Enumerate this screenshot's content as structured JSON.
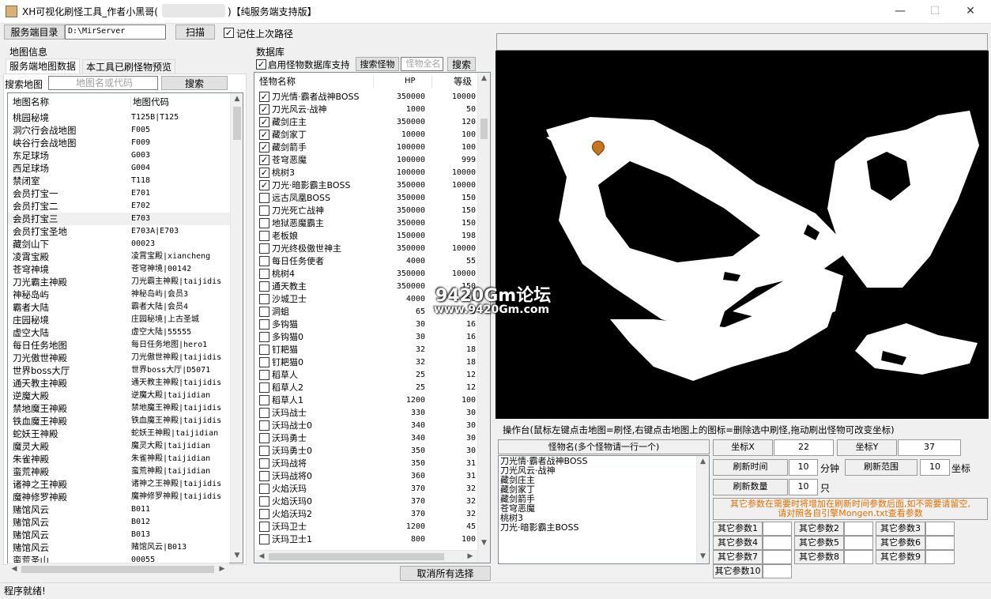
{
  "window": {
    "title_prefix": "XH可视化刷怪工具_作者小黑哥(",
    "title_suffix": ")【纯服务端支持版】",
    "minimize": "—",
    "maximize": "☐",
    "close": "✕"
  },
  "toolbar": {
    "server_dir_label": "服务端目录",
    "server_dir_value": "D:\\MirServer",
    "scan_button": "扫描",
    "remember_label": "记住上次路径",
    "remember_checked": true
  },
  "map_info": {
    "section_title": "地图信息",
    "tab_server": "服务端地图数据",
    "tab_existing": "本工具已刷怪物预览",
    "search_label": "搜索地图",
    "search_placeholder": "地图名或代码",
    "search_button": "搜索",
    "col_name": "地图名称",
    "col_code": "地图代码",
    "rows": [
      [
        "桃园秘境",
        "T125B|T125"
      ],
      [
        "洞穴行会战地图",
        "F005"
      ],
      [
        "峡谷行会战地图",
        "F009"
      ],
      [
        "东足球场",
        "G003"
      ],
      [
        "西足球场",
        "G004"
      ],
      [
        "禁闭室",
        "T118"
      ],
      [
        "会员打宝一",
        "E701"
      ],
      [
        "会员打宝二",
        "E702"
      ],
      [
        "会员打宝三",
        "E703"
      ],
      [
        "会员打宝圣地",
        "E703A|E703"
      ],
      [
        "藏剑山下",
        "00023"
      ],
      [
        "凌霄宝殿",
        "凌霄宝殿|xiancheng"
      ],
      [
        "苍穹神境",
        "苍穹神境|00142"
      ],
      [
        "刀光霸主神殿",
        "刀光霸主神殿|taijidis"
      ],
      [
        "神秘岛屿",
        "神秘岛屿|会员3"
      ],
      [
        "霸者大陆",
        "霸者大陆|会员4"
      ],
      [
        "庄园秘境",
        "庄园秘境|上古圣城"
      ],
      [
        "虚空大陆",
        "虚空大陆|55555"
      ],
      [
        "每日任务地图",
        "每日任务地图|hero1"
      ],
      [
        "刀光傲世神殿",
        "刀光傲世神殿|taijidis"
      ],
      [
        "世界boss大厅",
        "世界boss大厅|D5071"
      ],
      [
        "通天教主神殿",
        "通天教主神殿|taijidis"
      ],
      [
        "逆魔大殿",
        "逆魔大殿|taijidian"
      ],
      [
        "禁地魔王神殿",
        "禁地魔王神殿|taijidis"
      ],
      [
        "铁血魔王神殿",
        "铁血魔王神殿|taijidis"
      ],
      [
        "蛇妖王神殿",
        "蛇妖王神殿|taijidian"
      ],
      [
        "魔灵大殿",
        "魔灵大殿|taijidian"
      ],
      [
        "朱雀神殿",
        "朱雀神殿|taijidian"
      ],
      [
        "蛮荒神殿",
        "蛮荒神殿|taijidian"
      ],
      [
        "诸神之王神殿",
        "诸神之王神殿|taijidis"
      ],
      [
        "魔神修罗神殿",
        "魔神修罗神殿|taijidis"
      ],
      [
        "赌馆风云",
        "B011"
      ],
      [
        "赌馆风云",
        "B012"
      ],
      [
        "赌馆风云",
        "B013"
      ],
      [
        "赌馆风云",
        "赌馆风云|B013"
      ],
      [
        "蛮荒圣山",
        "00055"
      ]
    ]
  },
  "monster_db": {
    "section_title": "数据库",
    "enable_label": "启用怪物数据库支持",
    "enable_checked": true,
    "search_monster_button": "搜索怪物",
    "fullname_placeholder": "怪物全名",
    "search_button": "搜索",
    "col_name": "怪物名称",
    "col_hp": "HP",
    "col_level": "等级",
    "cancel_all": "取消所有选择",
    "rows": [
      [
        true,
        "刀光情·霸者战神BOSS",
        "350000",
        "10000"
      ],
      [
        true,
        "刀光风云·战神",
        "1000",
        "50"
      ],
      [
        true,
        "藏剑庄主",
        "350000",
        "120"
      ],
      [
        true,
        "藏剑家丁",
        "10000",
        "100"
      ],
      [
        true,
        "藏剑箭手",
        "100000",
        "100"
      ],
      [
        true,
        "苍穹恶魔",
        "100000",
        "999"
      ],
      [
        true,
        "桃树3",
        "100000",
        "10000"
      ],
      [
        true,
        "刀光·暗影霸主BOSS",
        "350000",
        "10000"
      ],
      [
        false,
        "远古凤凰BOSS",
        "350000",
        "150"
      ],
      [
        false,
        "刀光死亡战神",
        "350000",
        "150"
      ],
      [
        false,
        "地狱恶魔霸主",
        "350000",
        "150"
      ],
      [
        false,
        "老板娘",
        "150000",
        "198"
      ],
      [
        false,
        "刀光终极傲世神主",
        "350000",
        "10000"
      ],
      [
        false,
        "每日任务使者",
        "4000",
        "55"
      ],
      [
        false,
        "桃树4",
        "350000",
        "10000"
      ],
      [
        false,
        "通天教主",
        "350000",
        "150"
      ],
      [
        false,
        "沙城卫士",
        "4000",
        "150"
      ],
      [
        false,
        "洞蛆",
        "65",
        "9"
      ],
      [
        false,
        "多钩猫",
        "30",
        "16"
      ],
      [
        false,
        "多钩猫0",
        "30",
        "16"
      ],
      [
        false,
        "钉耙猫",
        "32",
        "18"
      ],
      [
        false,
        "钉耙猫0",
        "32",
        "18"
      ],
      [
        false,
        "稻草人",
        "25",
        "12"
      ],
      [
        false,
        "稻草人2",
        "25",
        "12"
      ],
      [
        false,
        "稻草人1",
        "1200",
        "100"
      ],
      [
        false,
        "沃玛战士",
        "330",
        "30"
      ],
      [
        false,
        "沃玛战士0",
        "340",
        "30"
      ],
      [
        false,
        "沃玛勇士",
        "340",
        "30"
      ],
      [
        false,
        "沃玛勇士0",
        "350",
        "30"
      ],
      [
        false,
        "沃玛战将",
        "350",
        "31"
      ],
      [
        false,
        "沃玛战将0",
        "360",
        "31"
      ],
      [
        false,
        "火焰沃玛",
        "370",
        "32"
      ],
      [
        false,
        "火焰沃玛0",
        "370",
        "32"
      ],
      [
        false,
        "火焰沃玛2",
        "370",
        "32"
      ],
      [
        false,
        "沃玛卫士",
        "1200",
        "45"
      ],
      [
        false,
        "沃玛卫士1",
        "800",
        "100"
      ]
    ]
  },
  "map_view": {
    "watermark_top": "9420Gm论坛",
    "watermark_bottom": "www.9420Gm.com",
    "marker_icon": "map-pin-icon"
  },
  "console": {
    "title": "操作台(鼠标左键点击地图=刷怪,右键点击地图上的图标=删除选中刷怪,拖动刷出怪物可改变坐标)",
    "monster_name_header": "怪物名(多个怪物请一行一个)",
    "monster_lines": [
      "刀光情·霸者战神BOSS",
      "刀光风云·战神",
      "藏剑庄主",
      "藏剑家丁",
      "藏剑箭手",
      "苍穹恶魔",
      "桃树3",
      "刀光·暗影霸主BOSS"
    ],
    "coord_x_label": "坐标X",
    "coord_x_value": "22",
    "coord_y_label": "坐标Y",
    "coord_y_value": "37",
    "refresh_time_label": "刷新时间",
    "refresh_time_value": "10",
    "refresh_time_unit": "分钟",
    "refresh_range_label": "刷新范围",
    "refresh_range_value": "10",
    "refresh_range_unit": "坐标",
    "refresh_count_label": "刷新数量",
    "refresh_count_value": "10",
    "refresh_count_unit": "只",
    "note_line1": "其它参数在需要时将增加在刷新时间参数后面,如不需要请留空,",
    "note_line2": "请对照各自引擎Mongen.txt查看参数",
    "params": [
      "其它参数1",
      "其它参数2",
      "其它参数3",
      "其它参数4",
      "其它参数5",
      "其它参数6",
      "其它参数7",
      "其它参数8",
      "其它参数9",
      "其它参数10"
    ]
  },
  "status": {
    "text": "程序就绪!"
  },
  "colors": {
    "note_orange": "#e07000",
    "map_bg": "#000000",
    "map_floor": "#ffffff",
    "marker": "#c8741e"
  }
}
